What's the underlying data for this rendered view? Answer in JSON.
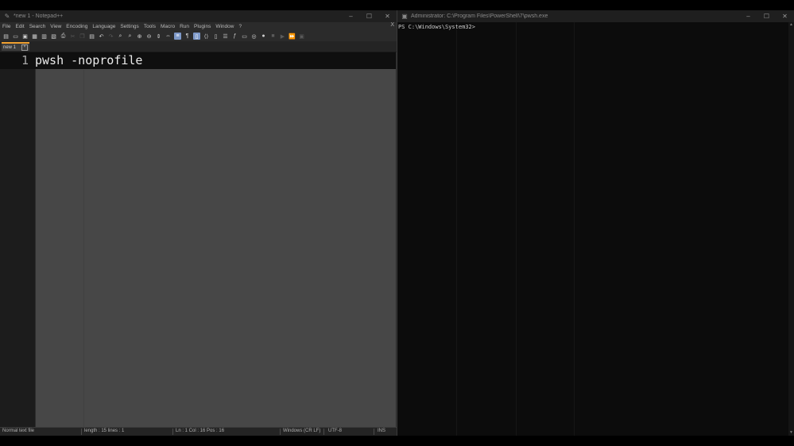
{
  "notepad": {
    "title": "*new 1 - Notepad++",
    "menu": [
      "File",
      "Edit",
      "Search",
      "View",
      "Encoding",
      "Language",
      "Settings",
      "Tools",
      "Macro",
      "Run",
      "Plugins",
      "Window",
      "?"
    ],
    "menu_close": "X",
    "tab": {
      "label": "new 1"
    },
    "editor": {
      "line_number": "1",
      "line_text": "pwsh -noprofile"
    },
    "status": {
      "file_type": "Normal text file",
      "length_lines": "length : 15    lines : 1",
      "position": "Ln : 1    Col : 16    Pos : 16",
      "eol": "Windows (CR LF)",
      "encoding": "UTF-8",
      "mode": "INS"
    }
  },
  "terminal": {
    "title": "Administrator: C:\\Program Files\\PowerShell\\7\\pwsh.exe",
    "prompt": "PS C:\\Windows\\System32>"
  },
  "window_buttons": {
    "minimize": "–",
    "maximize": "☐",
    "close": "✕"
  },
  "icons": {
    "notepad_app": "notepad-plus-plus-icon",
    "terminal_app": "terminal-icon"
  },
  "colors": {
    "tab_accent": "#f0a030",
    "toolbar_highlight": "#7e99c8"
  }
}
